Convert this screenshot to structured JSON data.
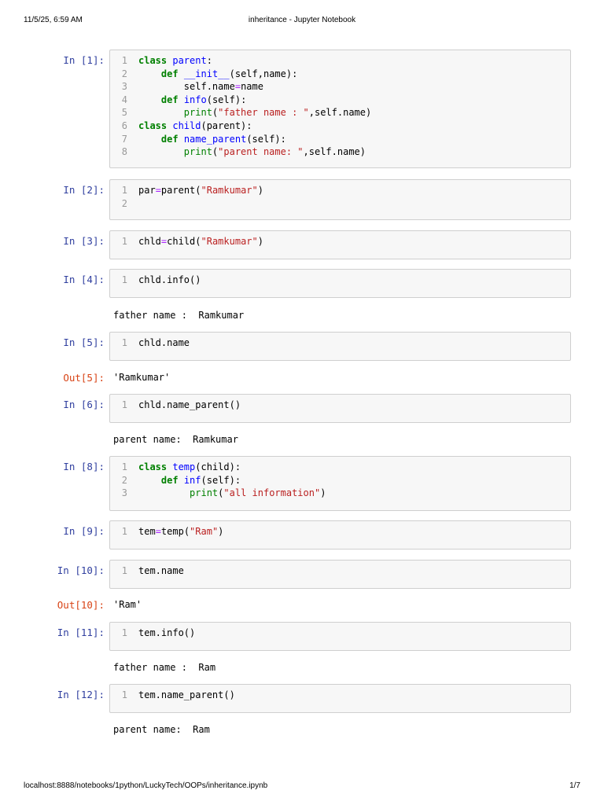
{
  "header": {
    "datetime": "11/5/25, 6:59 AM",
    "title": "inheritance - Jupyter Notebook"
  },
  "footer": {
    "url": "localhost:8888/notebooks/1python/LuckyTech/OOPs/inheritance.ipynb",
    "page": "1/7"
  },
  "cells": [
    {
      "prompt": "In [1]:",
      "lines": [
        [
          [
            "class",
            "k"
          ],
          [
            " ",
            ""
          ],
          [
            "parent",
            "d"
          ],
          [
            ":",
            ""
          ]
        ],
        [
          [
            "    ",
            ""
          ],
          [
            "def",
            "k"
          ],
          [
            " ",
            ""
          ],
          [
            "__init__",
            "d"
          ],
          [
            "(self,name):",
            ""
          ]
        ],
        [
          [
            "        self.name",
            ""
          ],
          [
            "=",
            "o"
          ],
          [
            "name",
            ""
          ]
        ],
        [
          [
            "    ",
            ""
          ],
          [
            "def",
            "k"
          ],
          [
            " ",
            ""
          ],
          [
            "info",
            "d"
          ],
          [
            "(self):",
            ""
          ]
        ],
        [
          [
            "        ",
            ""
          ],
          [
            "print",
            "b"
          ],
          [
            "(",
            ""
          ],
          [
            "\"father name : \"",
            "s"
          ],
          [
            ",self.name)",
            ""
          ]
        ],
        [
          [
            "class",
            "k"
          ],
          [
            " ",
            ""
          ],
          [
            "child",
            "d"
          ],
          [
            "(parent):",
            ""
          ]
        ],
        [
          [
            "    ",
            ""
          ],
          [
            "def",
            "k"
          ],
          [
            " ",
            ""
          ],
          [
            "name_parent",
            "d"
          ],
          [
            "(self):",
            ""
          ]
        ],
        [
          [
            "        ",
            ""
          ],
          [
            "print",
            "b"
          ],
          [
            "(",
            ""
          ],
          [
            "\"parent name: \"",
            "s"
          ],
          [
            ",self.name)",
            ""
          ]
        ]
      ]
    },
    {
      "prompt": "In [2]:",
      "lines": [
        [
          [
            "par",
            ""
          ],
          [
            "=",
            "o"
          ],
          [
            "parent(",
            ""
          ],
          [
            "\"Ramkumar\"",
            "s"
          ],
          [
            ")",
            ""
          ]
        ],
        []
      ]
    },
    {
      "prompt": "In [3]:",
      "lines": [
        [
          [
            "chld",
            ""
          ],
          [
            "=",
            "o"
          ],
          [
            "child(",
            ""
          ],
          [
            "\"Ramkumar\"",
            "s"
          ],
          [
            ")",
            ""
          ]
        ]
      ]
    },
    {
      "prompt": "In [4]:",
      "lines": [
        [
          [
            "chld.info()",
            ""
          ]
        ]
      ],
      "output": "father name :  Ramkumar"
    },
    {
      "prompt": "In [5]:",
      "lines": [
        [
          [
            "chld.name",
            ""
          ]
        ]
      ],
      "out_prompt": "Out[5]:",
      "output": "'Ramkumar'"
    },
    {
      "prompt": "In [6]:",
      "lines": [
        [
          [
            "chld.name_parent()",
            ""
          ]
        ]
      ],
      "output": "parent name:  Ramkumar"
    },
    {
      "prompt": "In [8]:",
      "lines": [
        [
          [
            "class",
            "k"
          ],
          [
            " ",
            ""
          ],
          [
            "temp",
            "d"
          ],
          [
            "(child):",
            ""
          ]
        ],
        [
          [
            "    ",
            ""
          ],
          [
            "def",
            "k"
          ],
          [
            " ",
            ""
          ],
          [
            "inf",
            "d"
          ],
          [
            "(self):",
            ""
          ]
        ],
        [
          [
            "         ",
            ""
          ],
          [
            "print",
            "b"
          ],
          [
            "(",
            ""
          ],
          [
            "\"all information\"",
            "s"
          ],
          [
            ")",
            ""
          ]
        ]
      ]
    },
    {
      "prompt": "In [9]:",
      "lines": [
        [
          [
            "tem",
            ""
          ],
          [
            "=",
            "o"
          ],
          [
            "temp(",
            ""
          ],
          [
            "\"Ram\"",
            "s"
          ],
          [
            ")",
            ""
          ]
        ]
      ]
    },
    {
      "prompt": "In [10]:",
      "lines": [
        [
          [
            "tem.name",
            ""
          ]
        ]
      ],
      "out_prompt": "Out[10]:",
      "output": "'Ram'"
    },
    {
      "prompt": "In [11]:",
      "lines": [
        [
          [
            "tem.info()",
            ""
          ]
        ]
      ],
      "output": "father name :  Ram"
    },
    {
      "prompt": "In [12]:",
      "lines": [
        [
          [
            "tem.name_parent()",
            ""
          ]
        ]
      ],
      "output": "parent name:  Ram"
    }
  ]
}
